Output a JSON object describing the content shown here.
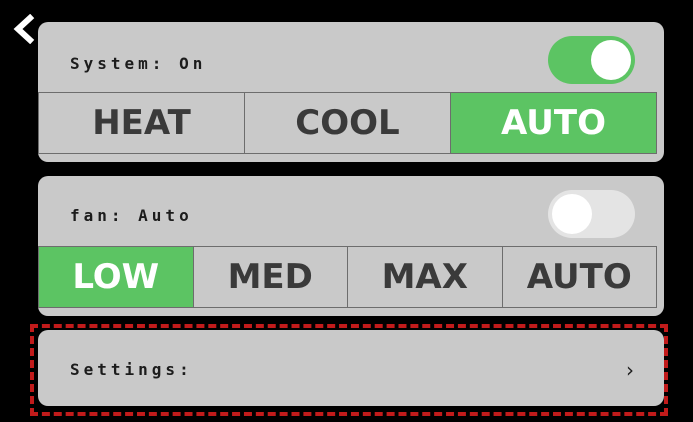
{
  "colors": {
    "background": "#000000",
    "card": "#c9c9c9",
    "accent_green": "#5cc463",
    "toggle_off": "#e4e4e4",
    "highlight": "#c11b1b"
  },
  "back": {
    "icon": "chevron-left-icon"
  },
  "system": {
    "label": "System: On",
    "toggle_on": true,
    "modes": [
      {
        "label": "HEAT",
        "active": false
      },
      {
        "label": "COOL",
        "active": false
      },
      {
        "label": "AUTO",
        "active": true
      }
    ]
  },
  "fan": {
    "label": "fan: Auto",
    "toggle_on": false,
    "speeds": [
      {
        "label": "LOW",
        "active": true
      },
      {
        "label": "MED",
        "active": false
      },
      {
        "label": "MAX",
        "active": false
      },
      {
        "label": "AUTO",
        "active": false
      }
    ]
  },
  "settings": {
    "label": "Settings:",
    "chevron": "›",
    "icon": "chevron-right-icon",
    "highlighted": true
  }
}
